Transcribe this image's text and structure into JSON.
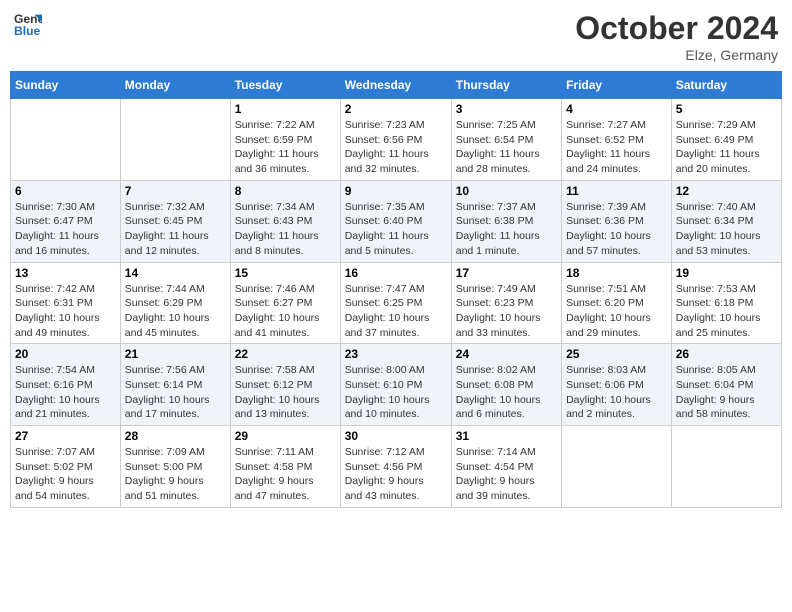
{
  "header": {
    "logo_line1": "General",
    "logo_line2": "Blue",
    "month_title": "October 2024",
    "location": "Elze, Germany"
  },
  "weekdays": [
    "Sunday",
    "Monday",
    "Tuesday",
    "Wednesday",
    "Thursday",
    "Friday",
    "Saturday"
  ],
  "weeks": [
    [
      {
        "day": "",
        "info": ""
      },
      {
        "day": "",
        "info": ""
      },
      {
        "day": "1",
        "info": "Sunrise: 7:22 AM\nSunset: 6:59 PM\nDaylight: 11 hours\nand 36 minutes."
      },
      {
        "day": "2",
        "info": "Sunrise: 7:23 AM\nSunset: 6:56 PM\nDaylight: 11 hours\nand 32 minutes."
      },
      {
        "day": "3",
        "info": "Sunrise: 7:25 AM\nSunset: 6:54 PM\nDaylight: 11 hours\nand 28 minutes."
      },
      {
        "day": "4",
        "info": "Sunrise: 7:27 AM\nSunset: 6:52 PM\nDaylight: 11 hours\nand 24 minutes."
      },
      {
        "day": "5",
        "info": "Sunrise: 7:29 AM\nSunset: 6:49 PM\nDaylight: 11 hours\nand 20 minutes."
      }
    ],
    [
      {
        "day": "6",
        "info": "Sunrise: 7:30 AM\nSunset: 6:47 PM\nDaylight: 11 hours\nand 16 minutes."
      },
      {
        "day": "7",
        "info": "Sunrise: 7:32 AM\nSunset: 6:45 PM\nDaylight: 11 hours\nand 12 minutes."
      },
      {
        "day": "8",
        "info": "Sunrise: 7:34 AM\nSunset: 6:43 PM\nDaylight: 11 hours\nand 8 minutes."
      },
      {
        "day": "9",
        "info": "Sunrise: 7:35 AM\nSunset: 6:40 PM\nDaylight: 11 hours\nand 5 minutes."
      },
      {
        "day": "10",
        "info": "Sunrise: 7:37 AM\nSunset: 6:38 PM\nDaylight: 11 hours\nand 1 minute."
      },
      {
        "day": "11",
        "info": "Sunrise: 7:39 AM\nSunset: 6:36 PM\nDaylight: 10 hours\nand 57 minutes."
      },
      {
        "day": "12",
        "info": "Sunrise: 7:40 AM\nSunset: 6:34 PM\nDaylight: 10 hours\nand 53 minutes."
      }
    ],
    [
      {
        "day": "13",
        "info": "Sunrise: 7:42 AM\nSunset: 6:31 PM\nDaylight: 10 hours\nand 49 minutes."
      },
      {
        "day": "14",
        "info": "Sunrise: 7:44 AM\nSunset: 6:29 PM\nDaylight: 10 hours\nand 45 minutes."
      },
      {
        "day": "15",
        "info": "Sunrise: 7:46 AM\nSunset: 6:27 PM\nDaylight: 10 hours\nand 41 minutes."
      },
      {
        "day": "16",
        "info": "Sunrise: 7:47 AM\nSunset: 6:25 PM\nDaylight: 10 hours\nand 37 minutes."
      },
      {
        "day": "17",
        "info": "Sunrise: 7:49 AM\nSunset: 6:23 PM\nDaylight: 10 hours\nand 33 minutes."
      },
      {
        "day": "18",
        "info": "Sunrise: 7:51 AM\nSunset: 6:20 PM\nDaylight: 10 hours\nand 29 minutes."
      },
      {
        "day": "19",
        "info": "Sunrise: 7:53 AM\nSunset: 6:18 PM\nDaylight: 10 hours\nand 25 minutes."
      }
    ],
    [
      {
        "day": "20",
        "info": "Sunrise: 7:54 AM\nSunset: 6:16 PM\nDaylight: 10 hours\nand 21 minutes."
      },
      {
        "day": "21",
        "info": "Sunrise: 7:56 AM\nSunset: 6:14 PM\nDaylight: 10 hours\nand 17 minutes."
      },
      {
        "day": "22",
        "info": "Sunrise: 7:58 AM\nSunset: 6:12 PM\nDaylight: 10 hours\nand 13 minutes."
      },
      {
        "day": "23",
        "info": "Sunrise: 8:00 AM\nSunset: 6:10 PM\nDaylight: 10 hours\nand 10 minutes."
      },
      {
        "day": "24",
        "info": "Sunrise: 8:02 AM\nSunset: 6:08 PM\nDaylight: 10 hours\nand 6 minutes."
      },
      {
        "day": "25",
        "info": "Sunrise: 8:03 AM\nSunset: 6:06 PM\nDaylight: 10 hours\nand 2 minutes."
      },
      {
        "day": "26",
        "info": "Sunrise: 8:05 AM\nSunset: 6:04 PM\nDaylight: 9 hours\nand 58 minutes."
      }
    ],
    [
      {
        "day": "27",
        "info": "Sunrise: 7:07 AM\nSunset: 5:02 PM\nDaylight: 9 hours\nand 54 minutes."
      },
      {
        "day": "28",
        "info": "Sunrise: 7:09 AM\nSunset: 5:00 PM\nDaylight: 9 hours\nand 51 minutes."
      },
      {
        "day": "29",
        "info": "Sunrise: 7:11 AM\nSunset: 4:58 PM\nDaylight: 9 hours\nand 47 minutes."
      },
      {
        "day": "30",
        "info": "Sunrise: 7:12 AM\nSunset: 4:56 PM\nDaylight: 9 hours\nand 43 minutes."
      },
      {
        "day": "31",
        "info": "Sunrise: 7:14 AM\nSunset: 4:54 PM\nDaylight: 9 hours\nand 39 minutes."
      },
      {
        "day": "",
        "info": ""
      },
      {
        "day": "",
        "info": ""
      }
    ]
  ]
}
